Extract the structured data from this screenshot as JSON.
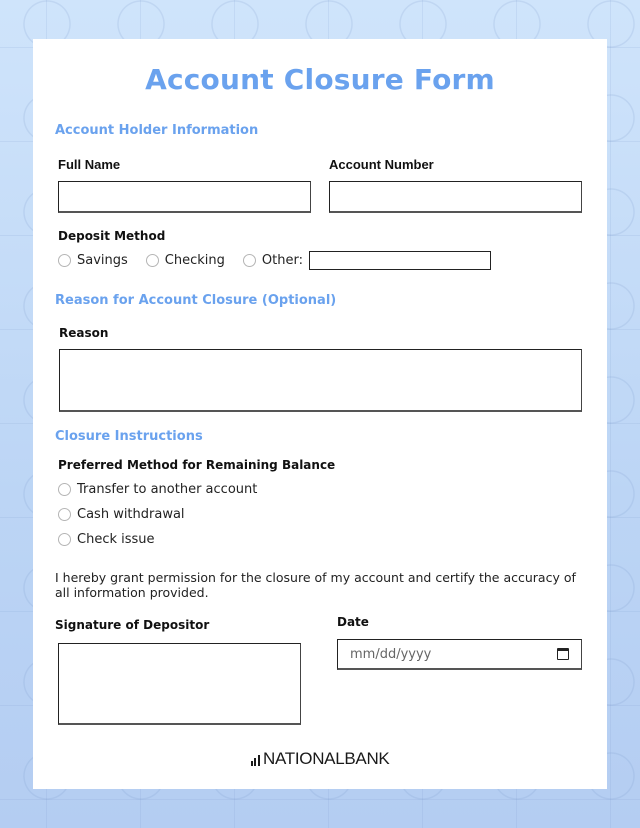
{
  "form": {
    "title": "Account Closure Form",
    "sections": {
      "holder": {
        "title": "Account Holder Information",
        "full_name_label": "Full Name",
        "full_name_value": "",
        "account_number_label": "Account Number",
        "account_number_value": "",
        "deposit_method_label": "Deposit Method",
        "deposit_options": [
          "Savings",
          "Checking",
          "Other:"
        ],
        "other_value": ""
      },
      "reason": {
        "title": "Reason for Account Closure (Optional)",
        "reason_label": "Reason",
        "reason_value": ""
      },
      "instructions": {
        "title": "Closure Instructions",
        "preferred_label": "Preferred Method for Remaining Balance",
        "options": [
          "Transfer to another account",
          "Cash withdrawal",
          "Check issue"
        ]
      }
    },
    "statement": "I hereby grant permission for the closure of my account and certify the accuracy of all information provided.",
    "signature_label": "Signature of Depositor",
    "date_label": "Date",
    "date_placeholder": "mm/dd/yyyy",
    "logo_text": "NATIONALBANK"
  },
  "colors": {
    "accent": "#6aa2ee",
    "background_top": "#cfe4fb",
    "background_bottom": "#b4cdf2"
  }
}
